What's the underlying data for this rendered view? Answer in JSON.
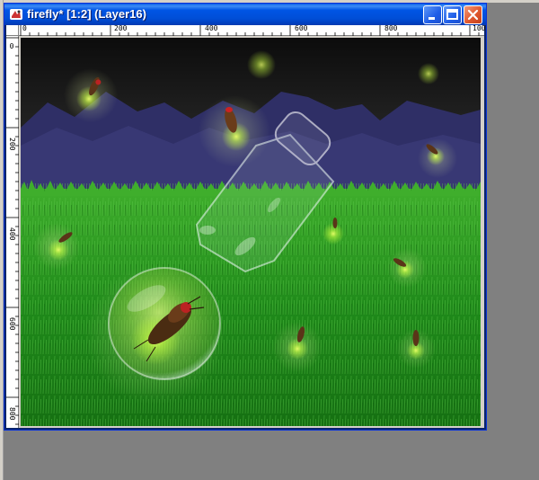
{
  "window": {
    "title": "firefly* [1:2] (Layer16)",
    "app_icon": "paint-app-icon",
    "buttons": [
      "minimize-icon",
      "maximize-icon",
      "close-icon"
    ]
  },
  "ruler": {
    "horizontal_labels": [
      "0",
      "200",
      "400",
      "600",
      "800",
      "100"
    ],
    "vertical_labels": [
      "0",
      "200",
      "400",
      "600",
      "800"
    ]
  },
  "colors": {
    "titlebar": "#0055e5",
    "close_button": "#e0582e",
    "grass": "#1f8a1a",
    "sky": "#1a1a1a",
    "mountains": "#2f2f66",
    "firefly_glow": "#c8ff40"
  }
}
